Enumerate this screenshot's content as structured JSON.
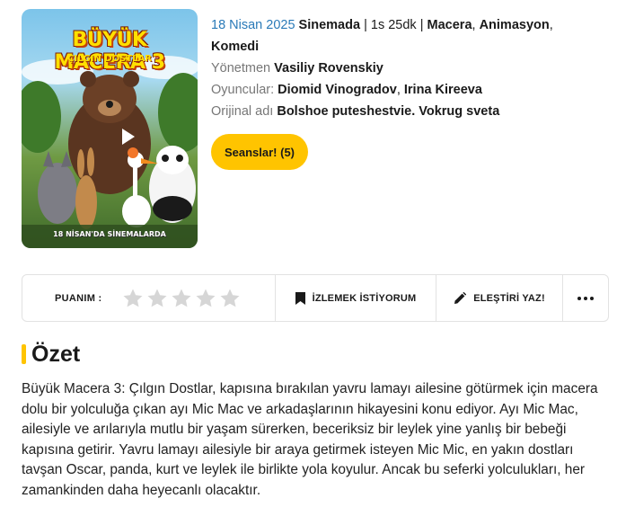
{
  "poster": {
    "title": "BÜYÜK MACERA 3",
    "subtitle": "ÇILGIN DOSTLAR",
    "tagline": "18 NİSAN'DA SİNEMALARDA"
  },
  "info": {
    "date": "18 Nisan 2025",
    "status": "Sinemada",
    "separator": "|",
    "duration": "1s 25dk",
    "genre_1": "Macera",
    "genre_2": "Animasyon",
    "genre_3": "Komedi",
    "director_label": "Yönetmen",
    "director": "Vasiliy Rovenskiy",
    "cast_label": "Oyuncular:",
    "cast_1": "Diomid Vinogradov",
    "cast_2": "Irina Kireeva",
    "original_title_label": "Orijinal adı",
    "original_title": "Bolshoe puteshestvie. Vokrug sveta"
  },
  "showtimes_button": "Seanslar! (5)",
  "action_bar": {
    "rating_label": "PUANIM :",
    "rating_value": 0,
    "rating_max": 5,
    "watchlist_label": "İZLEMEK İSTİYORUM",
    "review_label": "ELEŞTİRİ YAZ!"
  },
  "summary": {
    "title": "Özet",
    "text": "Büyük Macera 3: Çılgın Dostlar, kapısına bırakılan yavru lamayı ailesine götürmek için macera dolu bir yolculuğa çıkan ayı Mic Mac ve arkadaşlarının hikayesini konu ediyor. Ayı Mic Mac, ailesiyle ve arılarıyla mutlu bir yaşam sürerken, beceriksiz bir leylek yine yanlış bir bebeği kapısına getirir. Yavru lamayı ailesiyle bir araya getirmek isteyen Mic Mic, en yakın dostları tavşan Oscar, panda, kurt ve leylek ile birlikte yola koyulur. Ancak bu seferki yolculukları, her zamankinden daha heyecanlı olacaktır."
  },
  "colors": {
    "accent": "#ffc400",
    "date_blue": "#2a7ab8",
    "muted": "#777777",
    "star_empty": "#d6d6d6"
  },
  "icons": {
    "play": "play-icon",
    "star": "star-icon",
    "bookmark": "bookmark-icon",
    "pen": "pen-icon",
    "more": "more-dots-icon"
  }
}
